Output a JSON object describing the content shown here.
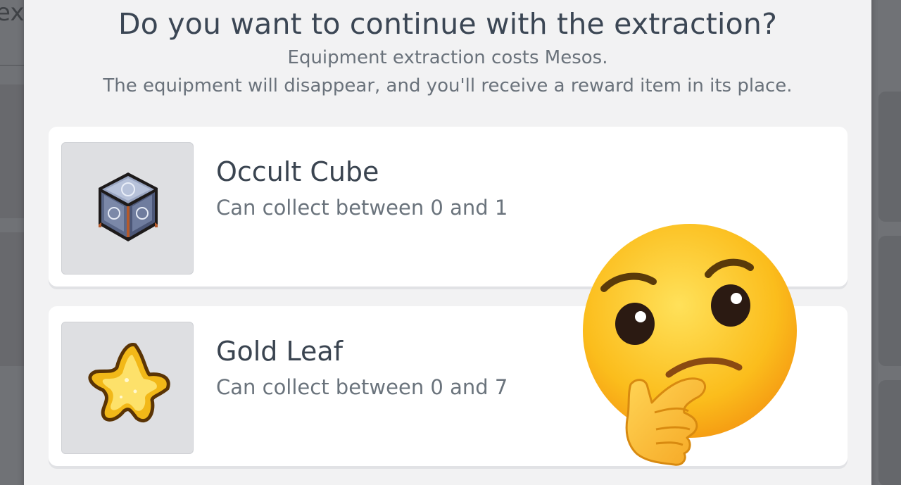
{
  "background": {
    "partial_text": "ex"
  },
  "dialog": {
    "title": "Do you want to continue with the extraction?",
    "subtitle_line1": "Equipment extraction costs Mesos.",
    "subtitle_line2": "The equipment will disappear, and you'll receive a reward item in its place."
  },
  "rewards": [
    {
      "name": "Occult Cube",
      "description": "Can collect between 0 and 1",
      "icon": "occult-cube-icon"
    },
    {
      "name": "Gold Leaf",
      "description": "Can collect between 0 and 7",
      "icon": "gold-leaf-icon"
    }
  ],
  "overlay": {
    "icon": "thinking-face-emoji"
  },
  "colors": {
    "dialog_bg": "#f2f2f3",
    "card_bg": "#ffffff",
    "title_text": "#3b4654",
    "sub_text": "#6a727b"
  }
}
